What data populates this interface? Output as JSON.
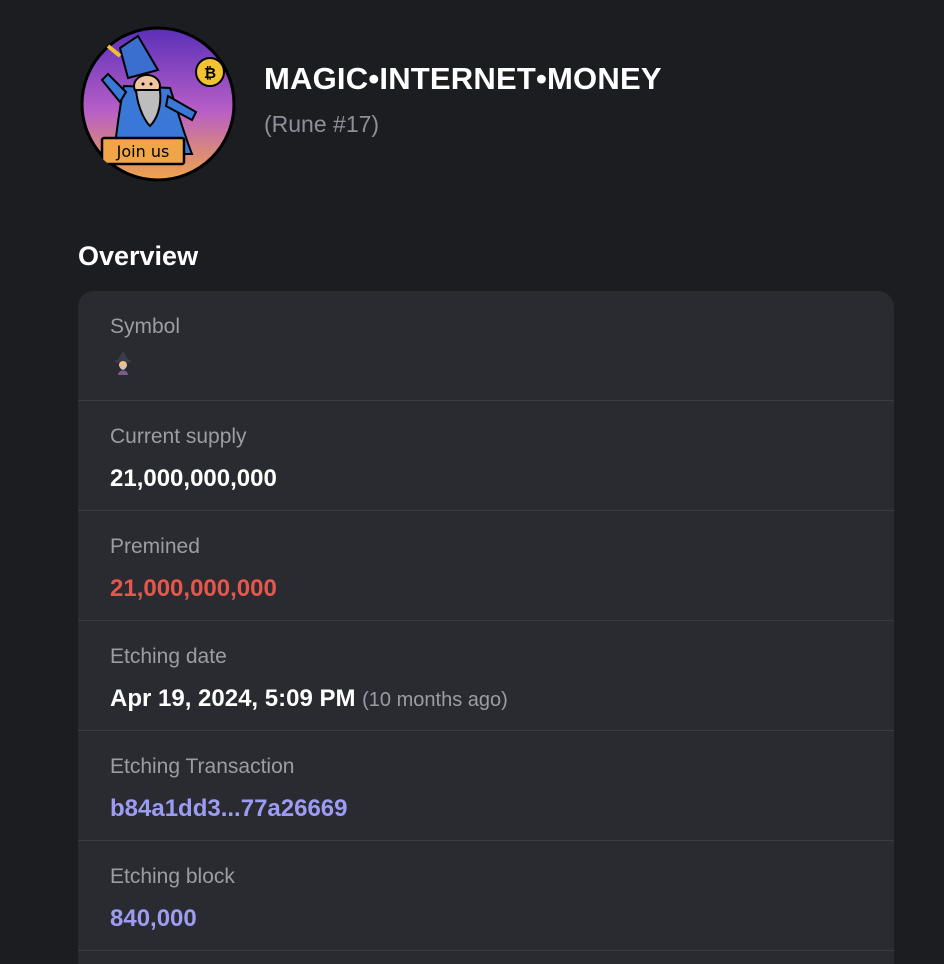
{
  "header": {
    "rune_name": "MAGIC•INTERNET•MONEY",
    "rune_number": "(Rune #17)",
    "avatar_icon": "wizard-avatar",
    "avatar_text": "Join us"
  },
  "overview": {
    "title": "Overview",
    "rows": [
      {
        "label": "Symbol",
        "value_icon": "wizard-emoji-icon"
      },
      {
        "label": "Current supply",
        "value": "21,000,000,000"
      },
      {
        "label": "Premined",
        "value": "21,000,000,000",
        "color": "#e5574c"
      },
      {
        "label": "Etching date",
        "value": "Apr 19, 2024, 5:09 PM",
        "suffix": "(10 months ago)"
      },
      {
        "label": "Etching Transaction",
        "value": "b84a1dd3...77a26669",
        "color": "#9c9cf2"
      },
      {
        "label": "Etching block",
        "value": "840,000",
        "color": "#9c9cf2"
      }
    ]
  }
}
